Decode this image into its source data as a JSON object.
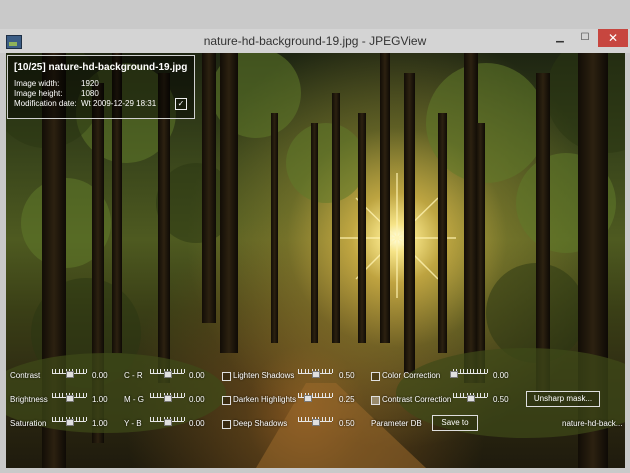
{
  "window": {
    "title": "nature-hd-background-19.jpg - JPEGView",
    "minimize_glyph": "▁",
    "maximize_glyph": "☐",
    "close_glyph": "✕"
  },
  "info_panel": {
    "header": "[10/25]  nature-hd-background-19.jpg",
    "rows": [
      {
        "label": "Image width:",
        "value": "1920"
      },
      {
        "label": "Image height:",
        "value": "1080"
      },
      {
        "label": "Modification date:",
        "value": "Wt 2009-12-29 18:31"
      }
    ],
    "checkbox_glyph": "✓"
  },
  "controls": {
    "contrast": {
      "label": "Contrast",
      "value": "0.00",
      "level": 0.5
    },
    "brightness": {
      "label": "Brightness",
      "value": "1.00",
      "level": 0.5
    },
    "saturation": {
      "label": "Saturation",
      "value": "1.00",
      "level": 0.5
    },
    "c_r": {
      "label": "C - R",
      "value": "0.00",
      "level": 0.5
    },
    "m_g": {
      "label": "M - G",
      "value": "0.00",
      "level": 0.5
    },
    "y_b": {
      "label": "Y - B",
      "value": "0.00",
      "level": 0.5
    },
    "lighten_shadows": {
      "label": "Lighten Shadows",
      "value": "0.50",
      "level": 0.5,
      "checked": false
    },
    "darken_highlights": {
      "label": "Darken Highlights",
      "value": "0.25",
      "level": 0.25,
      "checked": false
    },
    "deep_shadows": {
      "label": "Deep Shadows",
      "value": "0.50",
      "level": 0.5,
      "checked": false
    },
    "color_correction": {
      "label": "Color Correction",
      "value": "0.00",
      "level": 0.0,
      "checked": false
    },
    "contrast_correction": {
      "label": "Contrast Correction",
      "value": "0.50",
      "level": 0.5,
      "checked": true
    },
    "parameter_db_label": "Parameter DB",
    "save_to_label": "Save to",
    "unsharp_mask_label": "Unsharp mask...",
    "filename_short": "nature-hd-back..."
  },
  "colors": {
    "close_button": "#c7463f",
    "titlebar": "#d4d4d4"
  }
}
